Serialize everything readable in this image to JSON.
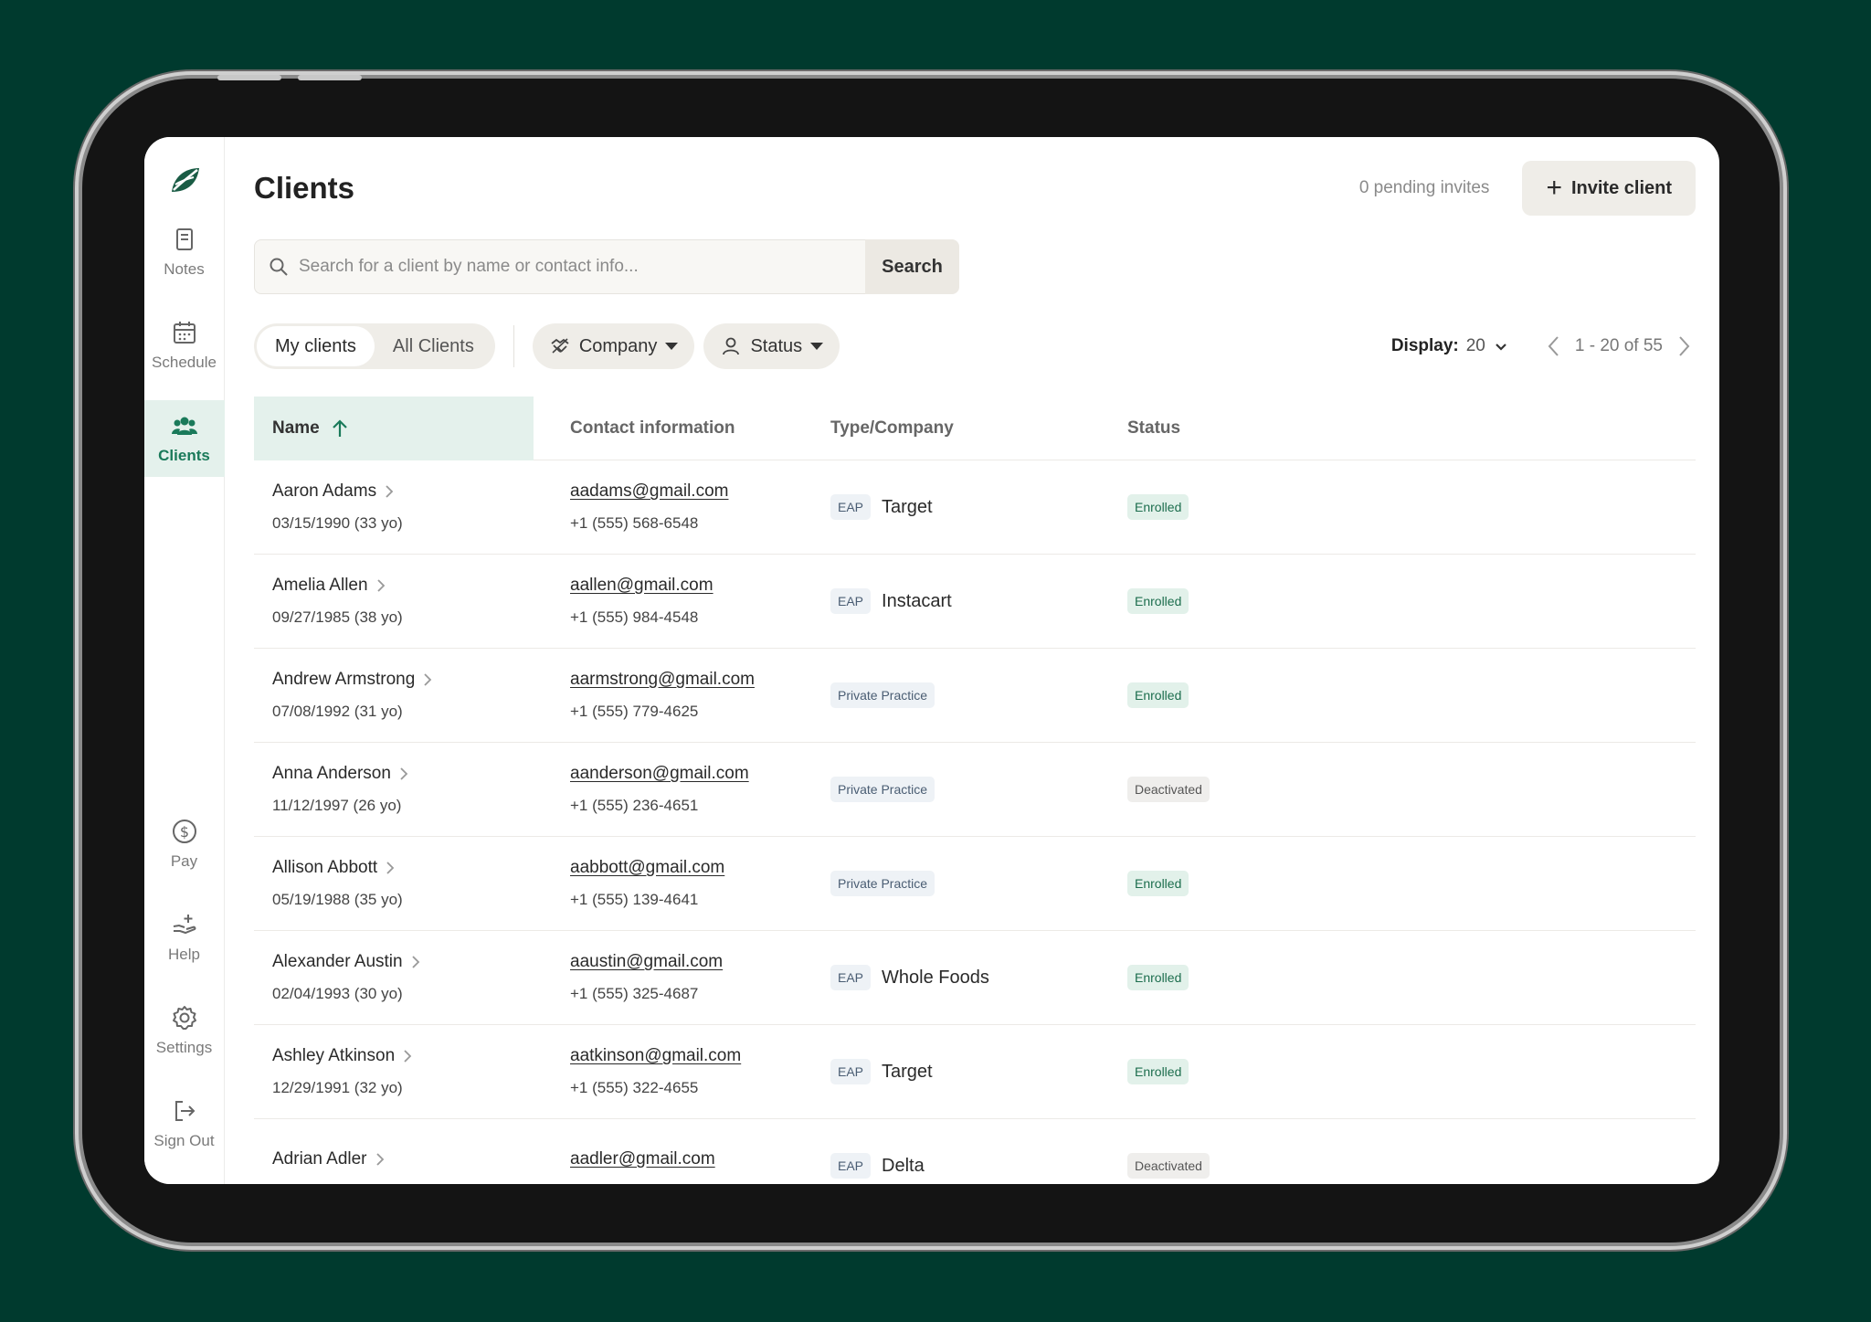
{
  "sidebar": {
    "nav": [
      {
        "label": "Notes",
        "icon": "notes-icon"
      },
      {
        "label": "Schedule",
        "icon": "calendar-icon"
      },
      {
        "label": "Clients",
        "icon": "clients-icon",
        "active": true
      }
    ],
    "bottom": [
      {
        "label": "Pay",
        "icon": "dollar-icon"
      },
      {
        "label": "Help",
        "icon": "help-hand-icon"
      },
      {
        "label": "Settings",
        "icon": "gear-icon"
      },
      {
        "label": "Sign Out",
        "icon": "sign-out-icon"
      }
    ]
  },
  "header": {
    "title": "Clients",
    "pending": "0 pending invites",
    "invite_label": "Invite client"
  },
  "search": {
    "placeholder": "Search for a client by name or contact info...",
    "button": "Search"
  },
  "filters": {
    "my_clients": "My clients",
    "all_clients": "All Clients",
    "company": "Company",
    "status": "Status",
    "display_label": "Display:",
    "display_value": "20",
    "page_range": "1 - 20 of 55"
  },
  "table": {
    "headers": {
      "name": "Name",
      "contact": "Contact information",
      "type": "Type/Company",
      "status": "Status"
    },
    "rows": [
      {
        "name": "Aaron Adams",
        "dob": "03/15/1990 (33 yo)",
        "email": "aadams@gmail.com",
        "phone": "+1 (555) 568-6548",
        "tag": "EAP",
        "company": "Target",
        "status": "Enrolled"
      },
      {
        "name": "Amelia Allen",
        "dob": "09/27/1985 (38 yo)",
        "email": "aallen@gmail.com",
        "phone": "+1 (555) 984-4548",
        "tag": "EAP",
        "company": "Instacart",
        "status": "Enrolled"
      },
      {
        "name": "Andrew Armstrong",
        "dob": "07/08/1992 (31 yo)",
        "email": "aarmstrong@gmail.com",
        "phone": "+1 (555) 779-4625",
        "tag": "Private Practice",
        "company": "",
        "status": "Enrolled"
      },
      {
        "name": "Anna Anderson",
        "dob": "11/12/1997 (26 yo)",
        "email": "aanderson@gmail.com",
        "phone": "+1 (555) 236-4651",
        "tag": "Private Practice",
        "company": "",
        "status": "Deactivated"
      },
      {
        "name": "Allison Abbott",
        "dob": "05/19/1988 (35 yo)",
        "email": "aabbott@gmail.com",
        "phone": "+1 (555) 139-4641",
        "tag": "Private Practice",
        "company": "",
        "status": "Enrolled"
      },
      {
        "name": "Alexander Austin",
        "dob": "02/04/1993 (30 yo)",
        "email": "aaustin@gmail.com",
        "phone": "+1 (555) 325-4687",
        "tag": "EAP",
        "company": "Whole Foods",
        "status": "Enrolled"
      },
      {
        "name": "Ashley Atkinson",
        "dob": "12/29/1991 (32 yo)",
        "email": "aatkinson@gmail.com",
        "phone": "+1 (555) 322-4655",
        "tag": "EAP",
        "company": "Target",
        "status": "Enrolled"
      },
      {
        "name": "Adrian Adler",
        "dob": "",
        "email": "aadler@gmail.com",
        "phone": "",
        "tag": "EAP",
        "company": "Delta",
        "status": "Deactivated"
      }
    ]
  },
  "colors": {
    "background": "#003a2e",
    "accent": "#1a7a5a",
    "active_bg": "#e4f1ec"
  }
}
